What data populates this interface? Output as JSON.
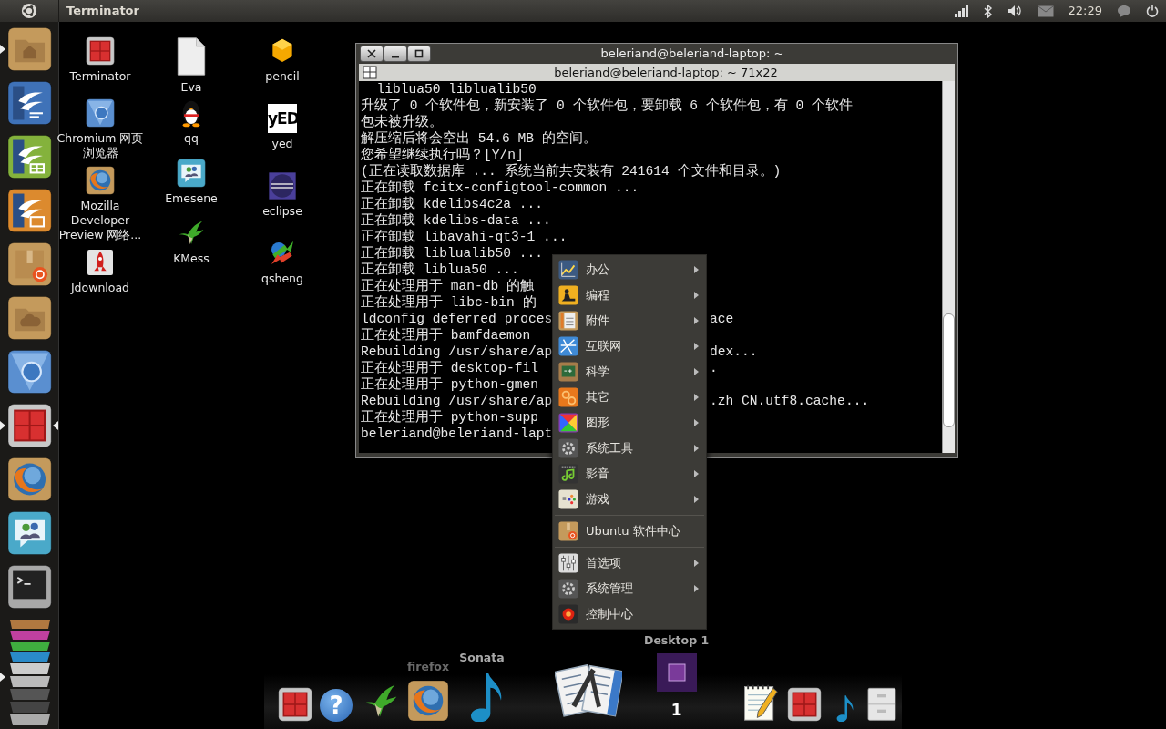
{
  "top_panel": {
    "app_title": "Terminator",
    "clock": "22:29"
  },
  "launcher": {
    "items": [
      {
        "kind": "home",
        "running": true,
        "focused": false
      },
      {
        "kind": "writer",
        "running": false,
        "focused": false
      },
      {
        "kind": "calc",
        "running": false,
        "focused": false
      },
      {
        "kind": "impress",
        "running": false,
        "focused": false
      },
      {
        "kind": "software",
        "running": false,
        "focused": false
      },
      {
        "kind": "cloud",
        "running": false,
        "focused": false
      },
      {
        "kind": "chromium",
        "running": false,
        "focused": false
      },
      {
        "kind": "terminator",
        "running": true,
        "focused": true
      },
      {
        "kind": "firefox",
        "running": false,
        "focused": false
      },
      {
        "kind": "emesene",
        "running": false,
        "focused": false
      },
      {
        "kind": "terminal",
        "running": false,
        "focused": false
      }
    ],
    "overflow": {
      "running": true
    }
  },
  "desktop_icons": [
    [
      {
        "kind": "terminator",
        "label": "Terminator"
      },
      {
        "kind": "chromium",
        "label": "Chromium 网页浏览器"
      },
      {
        "kind": "firefox",
        "label": "Mozilla Developer Preview 网络..."
      },
      {
        "kind": "jdownload",
        "label": "Jdownload"
      }
    ],
    [
      {
        "kind": "blank",
        "label": "Eva"
      },
      {
        "kind": "qq",
        "label": "qq"
      },
      {
        "kind": "emesene",
        "label": "Emesene"
      },
      {
        "kind": "kmess",
        "label": "KMess"
      }
    ],
    [
      {
        "kind": "pencil",
        "label": "pencil"
      },
      {
        "kind": "yed",
        "label": "yed",
        "logo_text": "yED"
      },
      {
        "kind": "eclipse",
        "label": "eclipse"
      },
      {
        "kind": "qsheng",
        "label": "qsheng"
      }
    ]
  ],
  "terminal": {
    "window_title": "beleriand@beleriand-laptop: ~",
    "tab_title": "beleriand@beleriand-laptop: ~ 71x22",
    "lines": [
      {
        "left": "  liblua50 liblualib50"
      },
      {
        "left": "升级了 0 个软件包，新安装了 0 个软件包，要卸载 6 个软件包，有 0 个软件"
      },
      {
        "left": "包未被升级。"
      },
      {
        "left": "解压缩后将会空出 54.6 MB 的空间。"
      },
      {
        "left": "您希望继续执行吗？[Y/n]"
      },
      {
        "left": "(正在读取数据库 ... 系统当前共安装有 241614 个文件和目录。)"
      },
      {
        "left": "正在卸载 fcitx-configtool-common ..."
      },
      {
        "left": "正在卸载 kdelibs4c2a ..."
      },
      {
        "left": "正在卸载 kdelibs-data ..."
      },
      {
        "left": "正在卸载 libavahi-qt3-1 ..."
      },
      {
        "left": "正在卸载 liblualib50 ..."
      },
      {
        "left": "正在卸载 liblua50 ..."
      },
      {
        "left": "正在处理用于 man-db 的触"
      },
      {
        "left": "正在处理用于 libc-bin 的"
      },
      {
        "left": "ldconfig deferred proces",
        "right": "ace"
      },
      {
        "left": "正在处理用于 bamfdaemon"
      },
      {
        "left": "Rebuilding /usr/share/ap",
        "right": "dex..."
      },
      {
        "left": "正在处理用于 desktop-fil",
        "right": "."
      },
      {
        "left": "正在处理用于 python-gmen"
      },
      {
        "left": "Rebuilding /usr/share/ap",
        "right": ".zh_CN.utf8.cache..."
      },
      {
        "left": "正在处理用于 python-supp"
      },
      {
        "left": "beleriand@beleriand-lapt"
      }
    ]
  },
  "menu": {
    "groups": [
      [
        {
          "kind": "office",
          "label": "办公",
          "submenu": true
        },
        {
          "kind": "programming",
          "label": "编程",
          "submenu": true
        },
        {
          "kind": "accessories",
          "label": "附件",
          "submenu": true
        },
        {
          "kind": "internet",
          "label": "互联网",
          "submenu": true
        },
        {
          "kind": "science",
          "label": "科学",
          "submenu": true
        },
        {
          "kind": "other",
          "label": "其它",
          "submenu": true
        },
        {
          "kind": "graphics",
          "label": "图形",
          "submenu": true
        },
        {
          "kind": "systemtools",
          "label": "系统工具",
          "submenu": true
        },
        {
          "kind": "multimedia",
          "label": "影音",
          "submenu": true
        },
        {
          "kind": "games",
          "label": "游戏",
          "submenu": true
        }
      ],
      [
        {
          "kind": "software",
          "label": "Ubuntu 软件中心",
          "submenu": false
        }
      ],
      [
        {
          "kind": "preferences",
          "label": "首选项",
          "submenu": true
        },
        {
          "kind": "admin",
          "label": "系统管理",
          "submenu": true
        },
        {
          "kind": "control",
          "label": "控制中心",
          "submenu": false
        }
      ]
    ]
  },
  "dock": {
    "items": [
      {
        "kind": "terminator"
      },
      {
        "kind": "help",
        "glyph": "?"
      },
      {
        "kind": "kmess"
      },
      {
        "kind": "firefox",
        "label": "firefox",
        "faded": true
      },
      {
        "kind": "sonata",
        "label": "Sonata",
        "faded": false
      },
      {
        "kind": "menueditor"
      },
      {
        "kind": "pager",
        "label": "Desktop 1",
        "faded": false,
        "number": "1"
      },
      {
        "kind": "gedit"
      },
      {
        "kind": "terminator"
      },
      {
        "kind": "sonata"
      },
      {
        "kind": "cabinet"
      }
    ]
  }
}
